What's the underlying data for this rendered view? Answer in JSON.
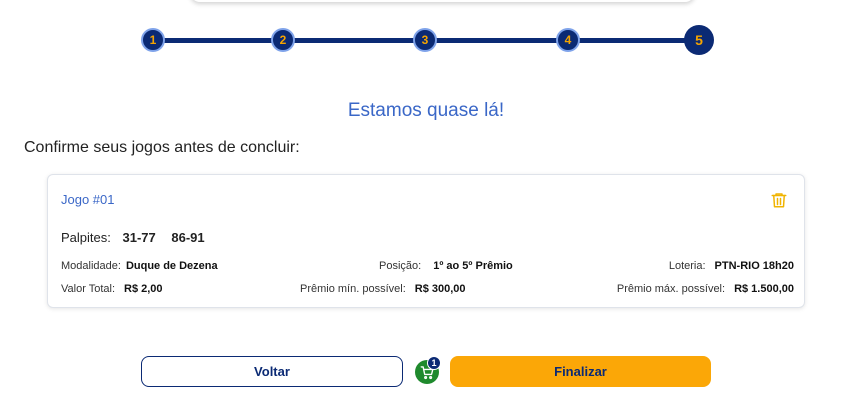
{
  "stepper": {
    "steps": [
      "1",
      "2",
      "3",
      "4",
      "5"
    ],
    "current_step": 5
  },
  "heading": "Estamos quase lá!",
  "subheading": "Confirme seus jogos antes de concluir:",
  "game": {
    "title": "Jogo #01",
    "palpites_label": "Palpites:",
    "palpites": [
      "31-77",
      "86-91"
    ],
    "modalidade_label": "Modalidade:",
    "modalidade": "Duque de Dezena",
    "posicao_label": "Posição:",
    "posicao": "1º ao 5º Prêmio",
    "loteria_label": "Loteria:",
    "loteria": "PTN-RIO 18h20",
    "valor_total_label": "Valor Total:",
    "valor_total": "R$ 2,00",
    "premio_min_label": "Prêmio mín. possível:",
    "premio_min": "R$ 300,00",
    "premio_max_label": "Prêmio máx. possível:",
    "premio_max": "R$ 1.500,00"
  },
  "actions": {
    "back_label": "Voltar",
    "finish_label": "Finalizar",
    "cart_count": "1"
  },
  "colors": {
    "navy": "#0b2a74",
    "accent_blue": "#3a67c7",
    "orange": "#fba707",
    "green": "#1f8a2d",
    "trash": "#f0b400"
  },
  "icons": [
    "trash-icon",
    "cart-icon"
  ]
}
